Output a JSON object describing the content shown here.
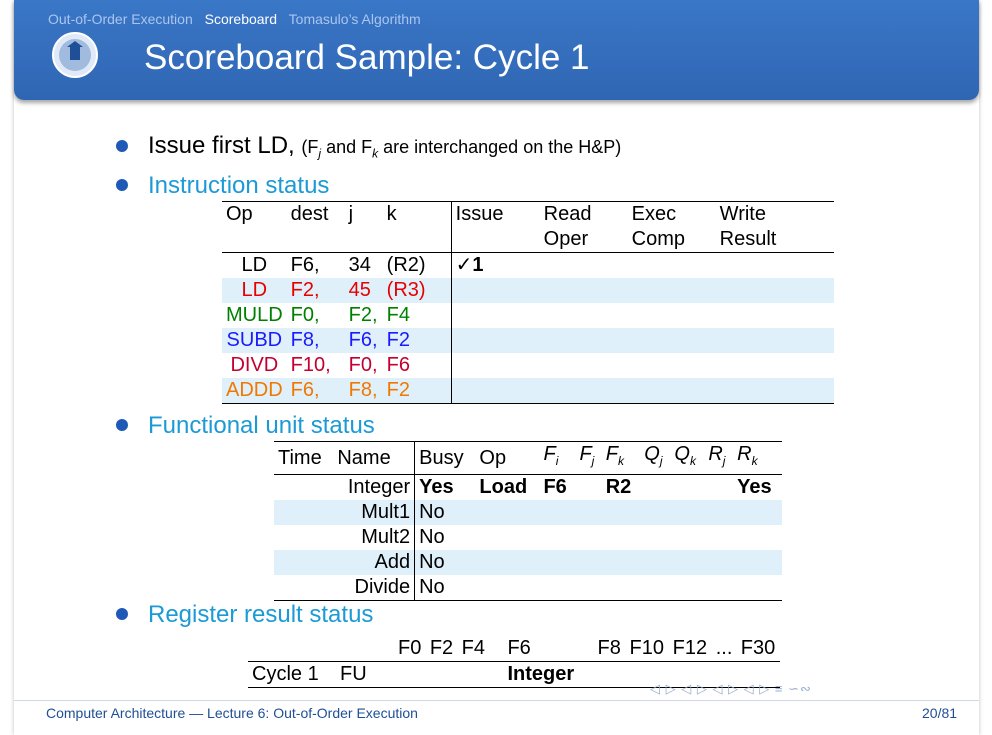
{
  "nav": [
    "Out-of-Order Execution",
    "Scoreboard",
    "Tomasulo’s Algorithm"
  ],
  "title": "Scoreboard Sample: Cycle 1",
  "bullets": {
    "issue_main": "Issue first LD,",
    "issue_note": "(F",
    "j": "j",
    "and": " and F",
    "k": "k",
    "rest": " are interchanged on the H&P)",
    "instr": "Instruction status",
    "fu": "Functional unit status",
    "reg": "Register result status"
  },
  "instr_table": {
    "headers": [
      "Op",
      "dest",
      "j",
      "k",
      "Issue",
      "Read",
      "Exec",
      "Write"
    ],
    "headers2": [
      "Oper",
      "Comp",
      "Result"
    ],
    "rows": [
      {
        "op": "LD",
        "dest": "F6,",
        "j": "34",
        "k": "(R2)",
        "issue": "✓1",
        "color": "#000000"
      },
      {
        "op": "LD",
        "dest": "F2,",
        "j": "45",
        "k": "(R3)",
        "issue": "",
        "color": "#e60000"
      },
      {
        "op": "MULD",
        "dest": "F0,",
        "j": "F2,",
        "k": "F4",
        "issue": "",
        "color": "#008000"
      },
      {
        "op": "SUBD",
        "dest": "F8,",
        "j": "F6,",
        "k": "F2",
        "issue": "",
        "color": "#1a1aff"
      },
      {
        "op": "DIVD",
        "dest": "F10,",
        "j": "F0,",
        "k": "F6",
        "issue": "",
        "color": "#c40030"
      },
      {
        "op": "ADDD",
        "dest": "F6,",
        "j": "F8,",
        "k": "F2",
        "issue": "",
        "color": "#f07800"
      }
    ]
  },
  "fu_table": {
    "headers": [
      "Time",
      "Name",
      "Busy",
      "Op",
      "F",
      "i",
      "F",
      "j",
      "F",
      "k",
      "Q",
      "j",
      "Q",
      "k",
      "R",
      "j",
      "R",
      "k"
    ],
    "rows": [
      {
        "name": "Integer",
        "busy": "Yes",
        "op": "Load",
        "fi": "F6",
        "fj": "",
        "fk": "R2",
        "qj": "",
        "qk": "",
        "rj": "",
        "rk": "Yes"
      },
      {
        "name": "Mult1",
        "busy": "No",
        "op": "",
        "fi": "",
        "fj": "",
        "fk": "",
        "qj": "",
        "qk": "",
        "rj": "",
        "rk": ""
      },
      {
        "name": "Mult2",
        "busy": "No",
        "op": "",
        "fi": "",
        "fj": "",
        "fk": "",
        "qj": "",
        "qk": "",
        "rj": "",
        "rk": ""
      },
      {
        "name": "Add",
        "busy": "No",
        "op": "",
        "fi": "",
        "fj": "",
        "fk": "",
        "qj": "",
        "qk": "",
        "rj": "",
        "rk": ""
      },
      {
        "name": "Divide",
        "busy": "No",
        "op": "",
        "fi": "",
        "fj": "",
        "fk": "",
        "qj": "",
        "qk": "",
        "rj": "",
        "rk": ""
      }
    ]
  },
  "reg_table": {
    "regs": [
      "F0",
      "F2",
      "F4",
      "F6",
      "F8",
      "F10",
      "F12",
      "...",
      "F30"
    ],
    "cycle": "Cycle 1",
    "fu": "FU",
    "values": [
      "",
      "",
      "",
      "Integer",
      "",
      "",
      "",
      "",
      ""
    ]
  },
  "footer": "Computer Architecture — Lecture 6: Out-of-Order Execution",
  "page": "20/81",
  "nav_icons": "◁ ▷ ◁ ▷ ◁ ▷ ◁ ▷ ≡ ∽∾"
}
